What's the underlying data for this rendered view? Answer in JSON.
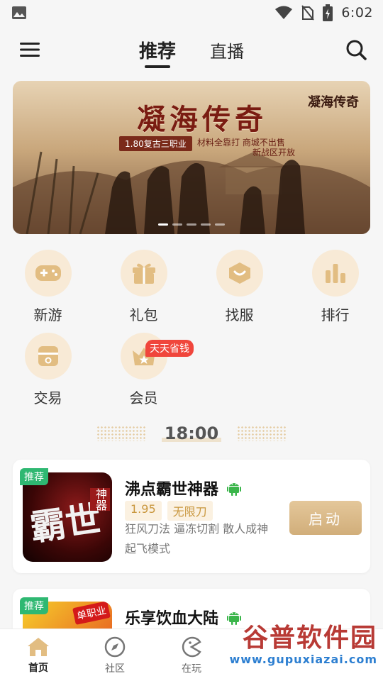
{
  "status_bar": {
    "time": "6:02"
  },
  "top_nav": {
    "tabs": [
      {
        "label": "推荐",
        "active": true
      },
      {
        "label": "直播",
        "active": false
      }
    ]
  },
  "banner": {
    "title": "凝海传奇",
    "logo": "凝海传奇",
    "line1": "1.80复古三职业",
    "line2": "材料全靠打 商城不出售",
    "line3": "新战区开放",
    "page_dots": 5,
    "active_dot": 0
  },
  "categories": [
    {
      "label": "新游",
      "icon": "gamepad-icon"
    },
    {
      "label": "礼包",
      "icon": "gift-icon"
    },
    {
      "label": "找服",
      "icon": "server-heart-icon"
    },
    {
      "label": "排行",
      "icon": "ranking-bars-icon"
    },
    {
      "label": "交易",
      "icon": "trade-box-icon"
    },
    {
      "label": "会员",
      "icon": "crown-icon",
      "badge": "天天省钱"
    }
  ],
  "time_divider": "18:00",
  "games": [
    {
      "tag": "推荐",
      "name": "沸点霸世神器",
      "platform_icon": "android-icon",
      "version": "1.95",
      "feature": "无限刀",
      "description": "狂风刀法 逼冻切割 散人成神 起飞模式",
      "button": "启动",
      "thumb_text": "霸世",
      "thumb_side": "神器"
    },
    {
      "tag": "推荐",
      "name": "乐享饮血大陆",
      "platform_icon": "android-icon",
      "thumb_badge": "单职业"
    }
  ],
  "bottom_nav": [
    {
      "label": "首页",
      "icon": "home-icon",
      "active": true
    },
    {
      "label": "社区",
      "icon": "compass-icon",
      "active": false
    },
    {
      "label": "在玩",
      "icon": "pacman-icon",
      "active": false
    },
    {
      "label": "",
      "icon": "",
      "active": false
    },
    {
      "label": "",
      "icon": "",
      "active": false
    }
  ],
  "watermark": {
    "top": "谷普软件园",
    "bottom": "www.gupuxiazai.com"
  },
  "colors": {
    "accent": "#d1ae7a",
    "tag_green": "#2fb872",
    "badge_red": "#f0463c",
    "category_bg": "#f8ead6",
    "category_icon": "#e2bd82"
  }
}
